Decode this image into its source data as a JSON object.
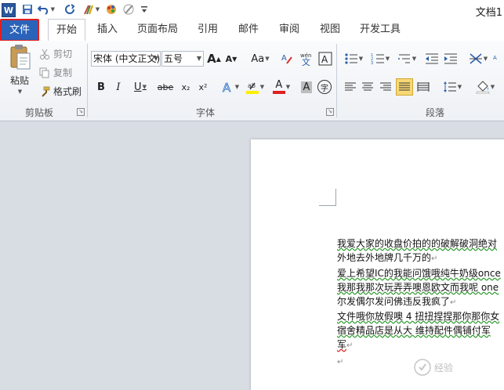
{
  "title_bar": {
    "app_icon_letter": "W",
    "title": "文档1"
  },
  "tabs": [
    {
      "label": "文件"
    },
    {
      "label": "开始"
    },
    {
      "label": "插入"
    },
    {
      "label": "页面布局"
    },
    {
      "label": "引用"
    },
    {
      "label": "邮件"
    },
    {
      "label": "审阅"
    },
    {
      "label": "视图"
    },
    {
      "label": "开发工具"
    }
  ],
  "clipboard": {
    "paste_label": "粘贴",
    "cut_label": "剪切",
    "copy_label": "复制",
    "format_painter_label": "格式刷",
    "group_label": "剪贴板"
  },
  "font": {
    "font_name": "宋体 (中文正文)",
    "font_size": "五号",
    "group_label": "字体",
    "grow_label": "A",
    "shrink_label": "A",
    "case_label": "Aa",
    "bold": "B",
    "italic": "I",
    "underline": "U",
    "strikethrough": "abe",
    "subscript": "x₂",
    "superscript": "x²",
    "font_color_label": "A",
    "char_shade_label": "A",
    "enclose_label": "字"
  },
  "paragraph": {
    "group_label": "段落"
  },
  "document": {
    "lines": [
      "我爱大家的收盘价拍的的破解破洞绝对",
      "外地去外地牌几千万的",
      "爱上希望IC的我能问饿哦纯牛奶级once",
      "我那我那次玩弄弄噢恩欧文而我呢 one",
      "尔发偶尔发问佛违反我疯了",
      "文件哦你放假噢 4 扭扭捏捏那你那你女",
      "宿舍精品店是从大 维持配件偶铺付军",
      "军"
    ]
  },
  "watermark": {
    "text": "经验"
  },
  "colors": {
    "file_tab_bg": "#2a63b9",
    "highlight_outline": "#e02020",
    "selected_button": "#f8d874"
  }
}
